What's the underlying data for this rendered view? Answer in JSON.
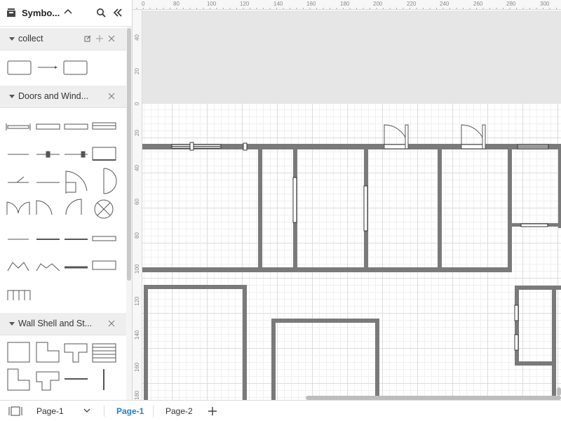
{
  "panel": {
    "title": "Symbo...",
    "sections": {
      "collect": "collect",
      "doors_windows": "Doors and Wind...",
      "wall_shell": "Wall Shell and St..."
    }
  },
  "ruler": {
    "top": [
      "0",
      "80",
      "100",
      "120",
      "140",
      "160",
      "180",
      "200",
      "220",
      "240",
      "260",
      "280",
      "300"
    ],
    "left": [
      "40",
      "20",
      "0",
      "20",
      "40",
      "60",
      "80",
      "100",
      "120",
      "140",
      "160",
      "180"
    ]
  },
  "bottom_bar": {
    "page_select": "Page-1",
    "tabs": [
      "Page-1",
      "Page-2"
    ]
  },
  "colors": {
    "wall": "#7a7a7a",
    "active_tab": "#1e7fd8"
  },
  "icons": [
    "library-icon",
    "chevron-up-icon",
    "search-icon",
    "double-chevron-left-icon",
    "edit-icon",
    "plus-icon",
    "close-icon",
    "caret-down-icon",
    "pages-icon",
    "chevron-down-icon",
    "add-page-icon"
  ]
}
